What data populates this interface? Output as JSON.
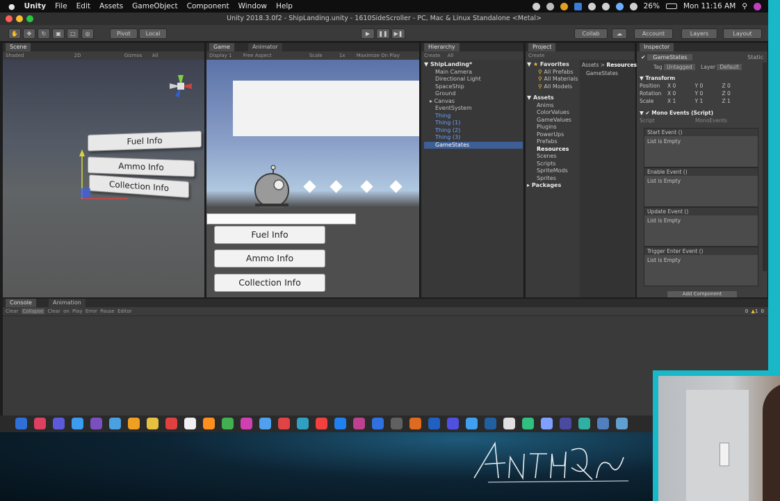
{
  "menubar": {
    "app": "Unity",
    "items": [
      "File",
      "Edit",
      "Assets",
      "GameObject",
      "Component",
      "Window",
      "Help"
    ],
    "battery": "26%",
    "clock": "Mon 11:16 AM"
  },
  "window": {
    "title": "Unity 2018.3.0f2 - ShipLanding.unity - 1610SideScroller - PC, Mac & Linux Standalone <Metal>"
  },
  "toolbar": {
    "pivot": "Pivot",
    "local": "Local",
    "collab": "Collab",
    "account": "Account",
    "layers": "Layers",
    "layout": "Layout"
  },
  "scene": {
    "tab": "Scene",
    "shaded": "Shaded",
    "twod": "2D",
    "gizmos": "Gizmos",
    "search": "All",
    "buttons": [
      "Fuel Info",
      "Ammo Info",
      "Collection Info"
    ]
  },
  "game": {
    "tab": "Game",
    "tab2": "Animator",
    "display": "Display 1",
    "aspect": "Free Aspect",
    "scale": "Scale",
    "scale_val": "1x",
    "maximize": "Maximize On Play",
    "buttons": [
      "Fuel Info",
      "Ammo Info",
      "Collection Info"
    ]
  },
  "hierarchy": {
    "tab": "Hierarchy",
    "create": "Create",
    "search": "All",
    "scene": "ShipLanding*",
    "items": [
      "Main Camera",
      "Directional Light",
      "SpaceShip",
      "Ground",
      "Canvas",
      "EventSystem",
      "Thing",
      "Thing (1)",
      "Thing (2)",
      "Thing (3)",
      "GameStates"
    ]
  },
  "project": {
    "tab": "Project",
    "create": "Create",
    "favorites": "Favorites",
    "fav_items": [
      "All Prefabs",
      "All Materials",
      "All Models"
    ],
    "assets": "Assets",
    "folders": [
      "Anims",
      "ColorValues",
      "GameValues",
      "Plugins",
      "PowerUps",
      "Prefabs",
      "Resources",
      "Scenes",
      "Scripts",
      "SpriteMods",
      "Sprites"
    ],
    "packages": "Packages",
    "crumb": [
      "Assets",
      "Resources"
    ],
    "file": "GameStates"
  },
  "inspector": {
    "tab": "Inspector",
    "object": "GameStates",
    "static": "Static",
    "tag_label": "Tag",
    "tag": "Untagged",
    "layer_label": "Layer",
    "layer": "Default",
    "transform": {
      "name": "Transform",
      "rows": [
        {
          "label": "Position",
          "x": "0",
          "y": "0",
          "z": "0"
        },
        {
          "label": "Rotation",
          "x": "0",
          "y": "0",
          "z": "0"
        },
        {
          "label": "Scale",
          "x": "1",
          "y": "1",
          "z": "1"
        }
      ]
    },
    "script": {
      "name": "Mono Events (Script)",
      "label": "Script",
      "value": "MonoEvents"
    },
    "events": [
      {
        "name": "Start Event ()",
        "body": "List is Empty"
      },
      {
        "name": "Enable Event ()",
        "body": "List is Empty"
      },
      {
        "name": "Update Event ()",
        "body": "List is Empty"
      },
      {
        "name": "Trigger Enter Event ()",
        "body": "List is Empty"
      }
    ],
    "add": "Add Component"
  },
  "console": {
    "tab": "Console",
    "tab2": "Animation",
    "tools": [
      "Clear",
      "Collapse",
      "Clear on Play",
      "Error Pause",
      "Editor"
    ],
    "counts": [
      "0",
      "1",
      "0"
    ]
  },
  "signature": "AnthonyRomrell",
  "colors": {
    "accent": "#19b8c8",
    "selection": "#3e5f96"
  }
}
